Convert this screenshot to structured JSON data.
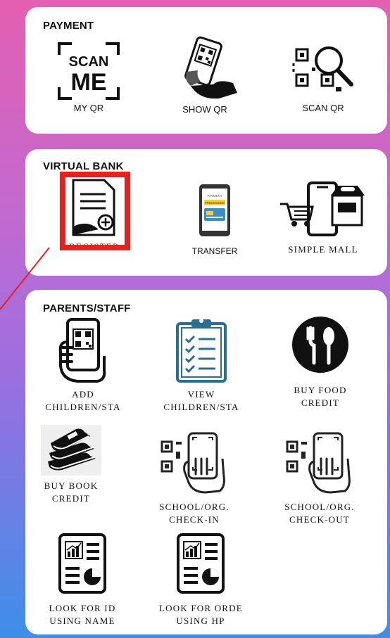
{
  "payment": {
    "title": "PAYMENT",
    "items": [
      {
        "label": "MY QR",
        "icon": "scan-me-icon",
        "scan_text_1": "SCAN",
        "scan_text_2": "ME"
      },
      {
        "label": "SHOW QR",
        "icon": "phone-qr-hand-icon"
      },
      {
        "label": "SCAN QR",
        "icon": "qr-magnifier-icon"
      }
    ]
  },
  "virtual_bank": {
    "title": "VIRTUAL BANK",
    "items": [
      {
        "label": "REGISTER",
        "icon": "register-document-icon"
      },
      {
        "label": "TRANSFER",
        "icon": "phone-transfer-icon",
        "screen_text_1": "PAYMENT",
        "screen_text_2": "PROCESSING"
      },
      {
        "label": "SIMPLE MALL",
        "icon": "phone-shopping-cart-icon"
      }
    ]
  },
  "parents_staff": {
    "title": "PARENTS/STAFF",
    "items": [
      {
        "label_1": "ADD",
        "label_2": "CHILDREN/STA",
        "icon": "hand-phone-qr-icon"
      },
      {
        "label_1": "VIEW",
        "label_2": "CHILDREN/STA",
        "icon": "clipboard-checklist-icon"
      },
      {
        "label_1": "BUY FOOD",
        "label_2": "CREDIT",
        "icon": "fork-spoon-icon"
      },
      {
        "label_1": "BUY BOOK",
        "label_2": "CREDIT",
        "icon": "books-stack-icon"
      },
      {
        "label_1": "SCHOOL/ORG.",
        "label_2": "CHECK-IN",
        "icon": "qr-hand-phone-icon"
      },
      {
        "label_1": "SCHOOL/ORG.",
        "label_2": "CHECK-OUT",
        "icon": "qr-hand-phone-icon"
      },
      {
        "label_1": "LOOK FOR ID",
        "label_2": "USING NAME",
        "icon": "report-chart-icon"
      },
      {
        "label_1": "LOOK FOR ORDEI",
        "label_2": "USING HP",
        "icon": "report-chart-icon"
      }
    ]
  },
  "colors": {
    "highlight": "#e8211e",
    "accent_blue": "#2a6f8f",
    "gradient_top": "#e45fb1",
    "gradient_bottom": "#3d8fe6"
  }
}
